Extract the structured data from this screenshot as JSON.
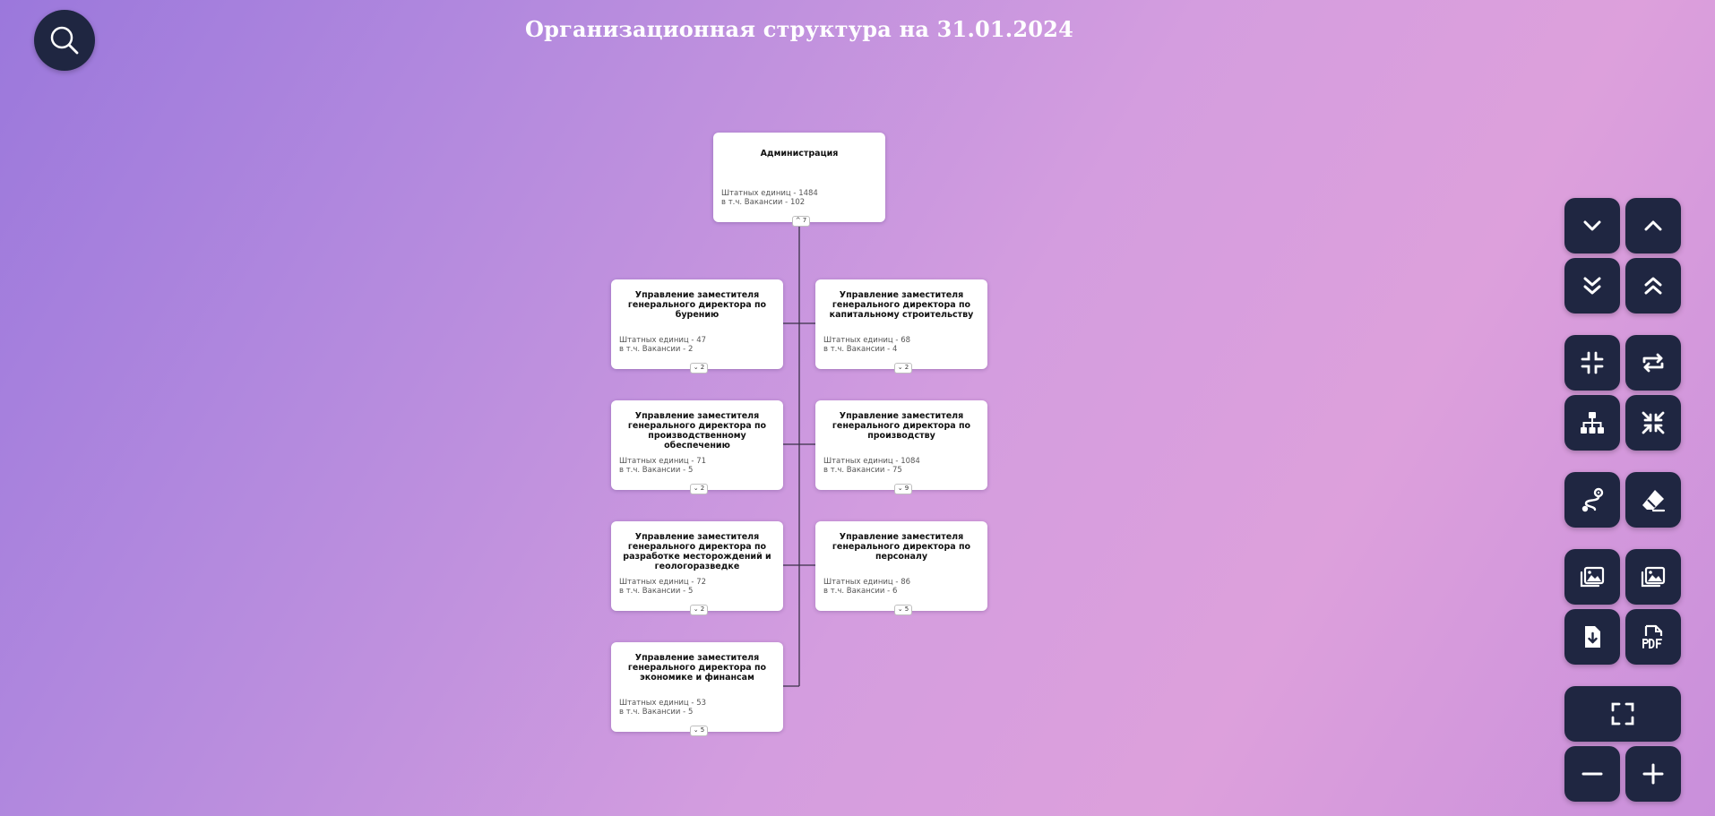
{
  "title": "Организационная структура на 31.01.2024",
  "stats_labels": {
    "staff": "Штатных единиц",
    "vacancies": "в т.ч. Вакансии"
  },
  "root": {
    "name": "Администрация",
    "staff": "1484",
    "vacancies": "102",
    "children": "7",
    "toggle": "^ 7"
  },
  "nodes": [
    {
      "name": "Управление заместителя генерального директора по бурению",
      "staff": "47",
      "vacancies": "2",
      "toggle": "⌄ 2"
    },
    {
      "name": "Управление заместителя генерального директора по капитальному строительству",
      "staff": "68",
      "vacancies": "4",
      "toggle": "⌄ 2"
    },
    {
      "name": "Управление заместителя генерального директора по производственному обеспечению",
      "staff": "71",
      "vacancies": "5",
      "toggle": "⌄ 2"
    },
    {
      "name": "Управление заместителя генерального директора по производству",
      "staff": "1084",
      "vacancies": "75",
      "toggle": "⌄ 9"
    },
    {
      "name": "Управление заместителя генерального директора по разработке месторождений и геологоразведке",
      "staff": "72",
      "vacancies": "5",
      "toggle": "⌄ 2"
    },
    {
      "name": "Управление заместителя генерального директора по персоналу",
      "staff": "86",
      "vacancies": "6",
      "toggle": "⌄ 5"
    },
    {
      "name": "Управление заместителя генерального директора по экономике и финансам",
      "staff": "53",
      "vacancies": "5",
      "toggle": "⌄ 5"
    }
  ],
  "icons": {
    "search": "search-icon",
    "controls": [
      "chevron-down-icon",
      "chevron-up-icon",
      "double-chevron-down-icon",
      "double-chevron-up-icon",
      "compress-icon",
      "swap-icon",
      "hierarchy-icon",
      "collapse-all-icon",
      "route-icon",
      "eraser-icon",
      "image-icon",
      "image-icon",
      "file-download-icon",
      "file-pdf-icon",
      "fullscreen-icon",
      "minus-icon",
      "plus-icon"
    ]
  },
  "colors": {
    "button_bg": "#1f2641",
    "line": "#3a3148",
    "card_bg": "#ffffff"
  }
}
